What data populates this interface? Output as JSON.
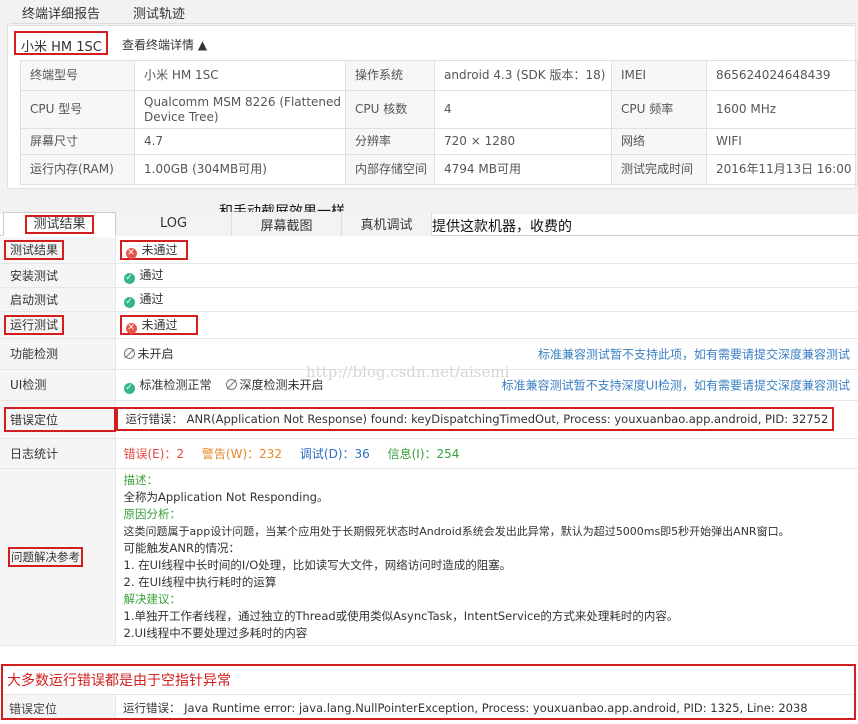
{
  "header": {
    "tab_report": "终端详细报告",
    "tab_trace": "测试轨迹",
    "device_name": "小米 HM 1SC",
    "device_toggle": "查看终端详情 ▲"
  },
  "device_info": {
    "rows": [
      [
        "终端型号",
        "小米 HM 1SC",
        "操作系统",
        "android 4.3 (SDK 版本：18)",
        "IMEI",
        "865624024648439"
      ],
      [
        "CPU 型号",
        "Qualcomm MSM 8226 (Flattened Device Tree)",
        "CPU 核数",
        "4",
        "CPU 频率",
        "1600 MHz"
      ],
      [
        "屏幕尺寸",
        "4.7",
        "分辨率",
        "720 × 1280",
        "网络",
        "WIFI"
      ],
      [
        "运行内存(RAM)",
        "1.00GB (304MB可用)",
        "内部存储空间",
        "4794 MB可用",
        "测试完成时间",
        "2016年11月13日 16:00"
      ]
    ]
  },
  "annotations": {
    "screenshot_note": "和手动截屏效果一样",
    "device_note": "提供这款机器，收费的"
  },
  "result_tabs": [
    "测试结果",
    "LOG",
    "屏幕截图",
    "真机调试"
  ],
  "results": {
    "test_result": {
      "label": "测试结果",
      "value": "未通过"
    },
    "install": {
      "label": "安装测试",
      "value": "通过"
    },
    "launch": {
      "label": "启动测试",
      "value": "通过"
    },
    "run": {
      "label": "运行测试",
      "value": "未通过"
    },
    "function": {
      "label": "功能检测",
      "value": "未开启",
      "link": "标准兼容测试暂不支持此项，如有需要请提交深度兼容测试"
    },
    "ui": {
      "label": "UI检测",
      "value": "标准检测正常",
      "value2": "深度检测未开启",
      "link": "标准兼容测试暂不支持深度UI检测，如有需要请提交深度兼容测试"
    },
    "error_locate": {
      "label": "错误定位",
      "value": "运行错误： ANR(Application Not Response) found: keyDispatchingTimedOut, Process: youxuanbao.app.android, PID: 32752"
    },
    "log_stats": {
      "label": "日志统计",
      "error": "错误(E)：2",
      "warn": "警告(W)：232",
      "debug": "调试(D)：36",
      "info": "信息(I)：254"
    },
    "solution": {
      "label": "问题解决参考",
      "desc_title": "描述：",
      "desc": "全称为Application Not Responding。",
      "cause_title": "原因分析：",
      "cause1": "这类问题属于app设计问题，当某个应用处于长期假死状态时Android系统会发出此异常，默认为超过5000ms即5秒开始弹出ANR窗口。",
      "cause2": "可能触发ANR的情况：",
      "cause3": "1. 在UI线程中长时间的I/O处理，比如读写大文件，网络访问时造成的阻塞。",
      "cause4": "2. 在UI线程中执行耗时的运算",
      "advice_title": "解决建议：",
      "advice1": "1.单独开工作者线程，通过独立的Thread或使用类似AsyncTask，IntentService的方式来处理耗时的内容。",
      "advice2": "2.UI线程中不要处理过多耗时的内容"
    }
  },
  "watermark": "http://blog.csdn.net/aisemi",
  "bottom": {
    "title": "大多数运行错误都是由于空指针异常",
    "label": "错误定位",
    "value": "运行错误： Java Runtime error: java.lang.NullPointerException, Process: youxuanbao.app.android, PID: 1325, Line: 2038"
  },
  "colors": {
    "red_box": "#d21e1e",
    "pass": "#33b78a",
    "fail": "#e8534a",
    "link": "#3b7fc4"
  }
}
